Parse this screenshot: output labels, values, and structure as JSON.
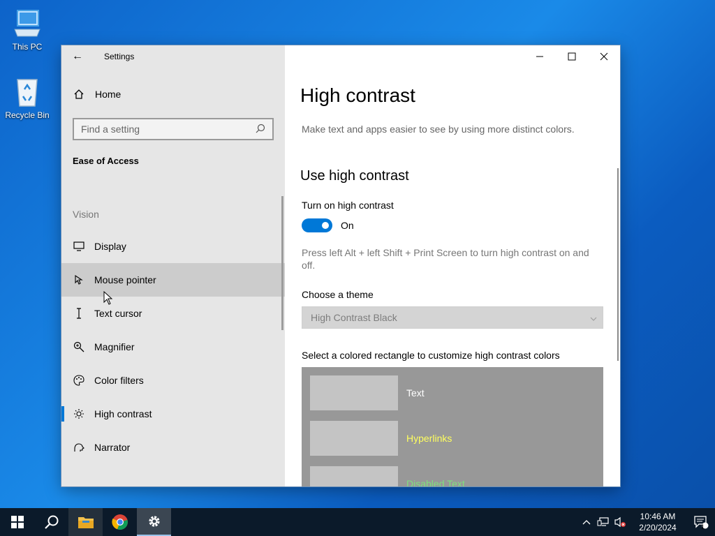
{
  "desktop": {
    "icons": [
      {
        "label": "This PC",
        "icon": "computer-icon"
      },
      {
        "label": "Recycle Bin",
        "icon": "recycle-bin-icon"
      }
    ]
  },
  "window": {
    "title": "Settings",
    "sidebar": {
      "home_label": "Home",
      "search_placeholder": "Find a setting",
      "section_title": "Ease of Access",
      "group_label": "Vision",
      "items": [
        {
          "label": "Display",
          "icon": "monitor-icon"
        },
        {
          "label": "Mouse pointer",
          "icon": "mouse-pointer-icon"
        },
        {
          "label": "Text cursor",
          "icon": "text-cursor-icon"
        },
        {
          "label": "Magnifier",
          "icon": "magnifier-icon"
        },
        {
          "label": "Color filters",
          "icon": "palette-icon"
        },
        {
          "label": "High contrast",
          "icon": "sun-icon"
        },
        {
          "label": "Narrator",
          "icon": "narrator-icon"
        }
      ],
      "hovered_item": "Mouse pointer",
      "selected_item": "High contrast"
    },
    "content": {
      "title": "High contrast",
      "description": "Make text and apps easier to see by using more distinct colors.",
      "subtitle": "Use high contrast",
      "toggle_label": "Turn on high contrast",
      "toggle_state": "On",
      "hint": "Press left Alt + left Shift + Print Screen to turn high contrast on and off.",
      "theme_label": "Choose a theme",
      "theme_value": "High Contrast Black",
      "colors_label": "Select a colored rectangle to customize high contrast colors",
      "color_items": [
        {
          "label": "Text",
          "color": "#ffffff"
        },
        {
          "label": "Hyperlinks",
          "color": "#ffff5e"
        },
        {
          "label": "Disabled Text",
          "color": "#7fe07f"
        }
      ]
    }
  },
  "taskbar": {
    "time": "10:46 AM",
    "date": "2/20/2024",
    "notification_count": "1",
    "accent": "#0078d7"
  }
}
